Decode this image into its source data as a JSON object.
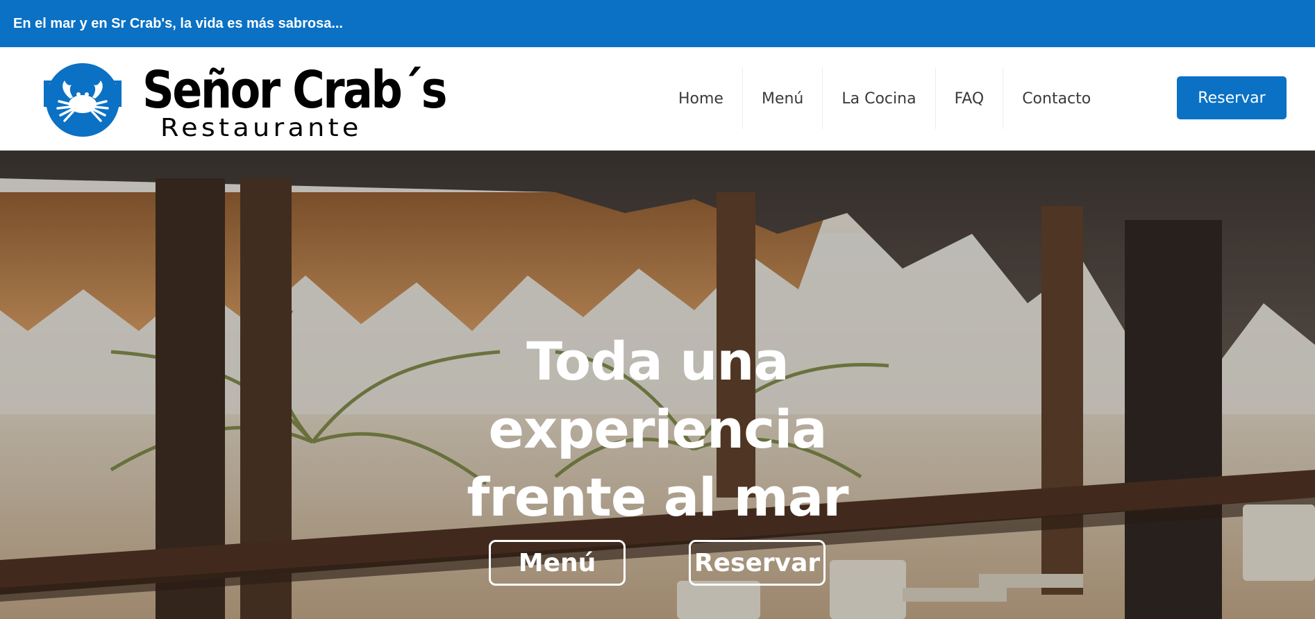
{
  "topbar": {
    "text": "En el mar y en Sr Crab's, la vida es más sabrosa..."
  },
  "logo": {
    "name": "Señor Crab´s",
    "subtitle": "Restaurante",
    "icon": "crab-icon"
  },
  "nav": {
    "items": [
      {
        "label": "Home"
      },
      {
        "label": "Menú"
      },
      {
        "label": "La Cocina"
      },
      {
        "label": "FAQ"
      },
      {
        "label": "Contacto"
      }
    ],
    "reserve_label": "Reservar"
  },
  "hero": {
    "title_lines": [
      "Toda una",
      "experiencia",
      "frente al mar"
    ],
    "menu_button": "Menú",
    "reserve_button": "Reservar",
    "image": "beach restaurant terrace with thatched roof and palm trees"
  },
  "colors": {
    "brand_blue": "#0a71c4",
    "white": "#ffffff",
    "nav_text": "#3a3a3a"
  }
}
